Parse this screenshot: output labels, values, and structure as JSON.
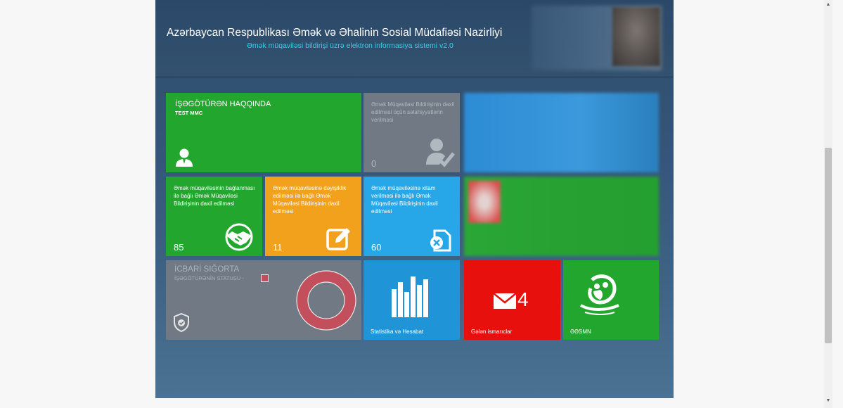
{
  "header": {
    "title": "Azərbaycan Respublikası Əmək və Əhalinin Sosial Müdafiəsi Nazirliyi",
    "subtitle": "Əmək müqaviləsi bildirişi üzrə elektron informasiya sistemi v2.0"
  },
  "tiles": {
    "employer": {
      "title": "İŞƏGÖTÜRƏN HAQQINDA",
      "company": "TEST MMC",
      "icon": "employee-icon"
    },
    "authority": {
      "label": "Əmək Müqaviləsi Bildirişinin daxil edilməsi üçün səlahiyyətlərin verilməsi",
      "count": "0",
      "icon": "user-check-icon"
    },
    "contract_new": {
      "label": "Əmək müqaviləsinin bağlanması ilə bağlı Əmək Müqaviləsi Bildirişinin daxil edilməsi",
      "count": "85",
      "icon": "handshake-icon"
    },
    "contract_change": {
      "label": "Əmək müqaviləsinə dəyişiklik edilməsi ilə bağlı Əmək Müqaviləsi Bildirişinin daxil edilməsi",
      "count": "11",
      "icon": "edit-icon"
    },
    "contract_end": {
      "label": "Əmək müqaviləsinə xitam verilməsi ilə bağlı Əmək Müqaviləsi Bildirişinin daxil edilməsi",
      "count": "60",
      "icon": "document-cancel-icon"
    },
    "insurance": {
      "title": "İCBARİ SIĞORTA",
      "status": "İŞƏGÖTÜRƏNİN STATUSU -",
      "status_color": "#c14e5a",
      "icon": "shield-icon"
    },
    "stats": {
      "label": "Statistika və Hesabat",
      "icon": "bar-chart-icon"
    },
    "mail": {
      "label": "Gələn ismarıclar",
      "count": "4",
      "icon": "mail-icon"
    },
    "esmn": {
      "label": "ƏƏSMN",
      "icon": "family-logo-icon"
    }
  },
  "colors": {
    "green": "#23a62e",
    "orange": "#f2a11c",
    "blue": "#27a6e8",
    "gray": "#717a84",
    "red": "#e8100c",
    "subtitle": "#2fd3e8"
  }
}
